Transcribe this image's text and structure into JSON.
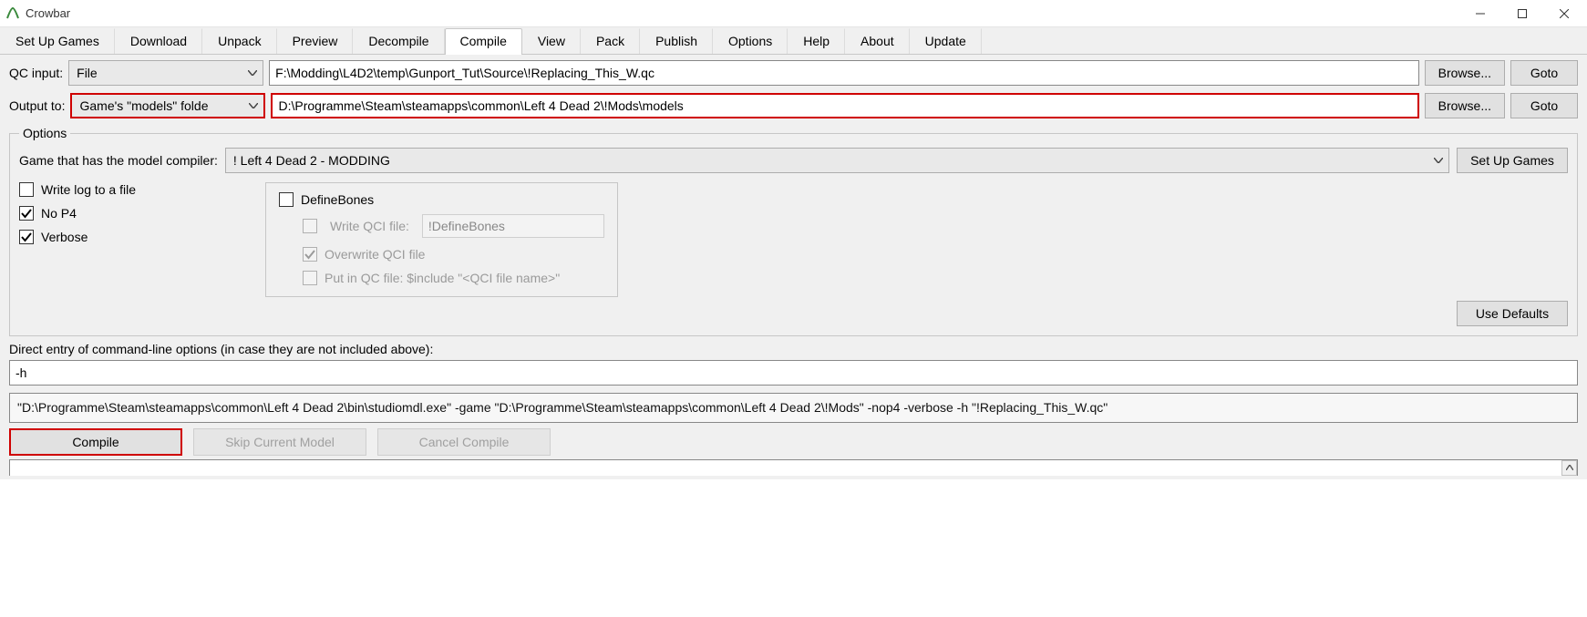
{
  "window": {
    "title": "Crowbar"
  },
  "tabs": [
    "Set Up Games",
    "Download",
    "Unpack",
    "Preview",
    "Decompile",
    "Compile",
    "View",
    "Pack",
    "Publish",
    "Options",
    "Help",
    "About",
    "Update"
  ],
  "activeTab": "Compile",
  "qcInput": {
    "label": "QC input:",
    "mode": "File",
    "path": "F:\\Modding\\L4D2\\temp\\Gunport_Tut\\Source\\!Replacing_This_W.qc",
    "browse": "Browse...",
    "goto": "Goto"
  },
  "outputTo": {
    "label": "Output to:",
    "mode": "Game's \"models\" folde",
    "path": "D:\\Programme\\Steam\\steamapps\\common\\Left 4 Dead 2\\!Mods\\models",
    "browse": "Browse...",
    "goto": "Goto"
  },
  "options": {
    "legend": "Options",
    "gameCompilerLabel": "Game that has the model compiler:",
    "gameCompiler": "! Left 4 Dead 2 - MODDING",
    "setUpGames": "Set Up Games",
    "checks": {
      "writeLog": {
        "label": "Write log to a file",
        "checked": false
      },
      "noP4": {
        "label": "No P4",
        "checked": true
      },
      "verbose": {
        "label": "Verbose",
        "checked": true
      }
    },
    "defineBones": {
      "label": "DefineBones",
      "checked": false,
      "writeQciLabel": "Write QCI file:",
      "writeQciValue": "!DefineBones",
      "overwriteQci": "Overwrite QCI file",
      "putInQc": "Put in QC file: $include \"<QCI file name>\""
    },
    "useDefaults": "Use Defaults"
  },
  "directEntry": {
    "label": "Direct entry of command-line options (in case they are not included above):",
    "value": "-h"
  },
  "commandLinePreview": "\"D:\\Programme\\Steam\\steamapps\\common\\Left 4 Dead 2\\bin\\studiomdl.exe\" -game \"D:\\Programme\\Steam\\steamapps\\common\\Left 4 Dead 2\\!Mods\" -nop4 -verbose -h \"!Replacing_This_W.qc\"",
  "actions": {
    "compile": "Compile",
    "skip": "Skip Current Model",
    "cancel": "Cancel Compile"
  }
}
